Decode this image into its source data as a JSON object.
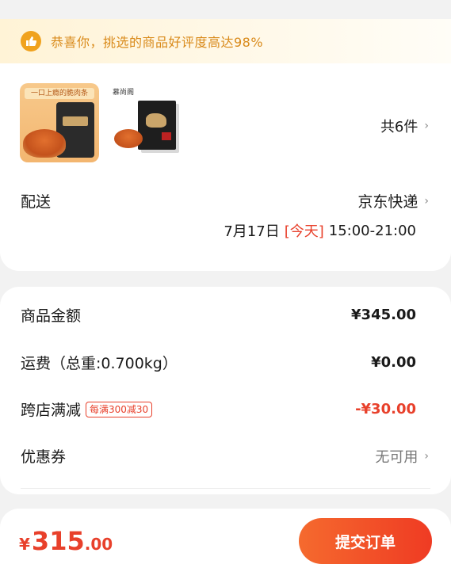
{
  "banner": {
    "text": "恭喜你，挑选的商品好评度高达98%",
    "icon": "thumbs-up-icon",
    "color": "#f0a21e"
  },
  "products": {
    "thumb1_text": "一口上瘾的脆肉条",
    "thumb2_brand": "慕尚阁",
    "count_label": "共6件"
  },
  "delivery": {
    "label": "配送",
    "method": "京东快递",
    "date": "7月17日",
    "today_tag": "[今天]",
    "time": "15:00-21:00"
  },
  "price": {
    "goods_label": "商品金额",
    "goods_value": "¥345.00",
    "shipping_label": "运费（总重:0.700kg）",
    "shipping_value": "¥0.00",
    "discount_label": "跨店满减",
    "discount_tag": "每满300减30",
    "discount_value": "-¥30.00",
    "coupon_label": "优惠券",
    "coupon_value": "无可用"
  },
  "footer": {
    "currency": "¥",
    "total_int": "315",
    "total_dec": ".00",
    "submit_label": "提交订单"
  },
  "colors": {
    "accent": "#e8402b",
    "banner_text": "#d98a1a"
  }
}
